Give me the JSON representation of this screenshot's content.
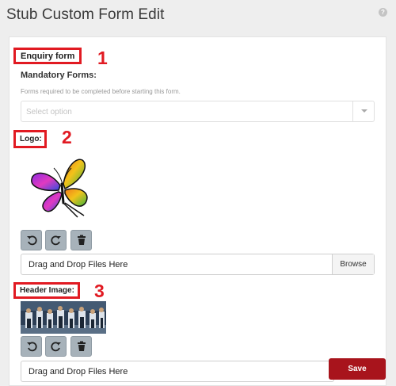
{
  "page": {
    "title": "Stub Custom Form Edit",
    "help_icon_text": "?"
  },
  "form": {
    "title": "Enquiry form",
    "mandatory_label": "Mandatory Forms:",
    "mandatory_help": "Forms required to be completed before starting this form.",
    "select_placeholder": "Select option"
  },
  "logo": {
    "label": "Logo:",
    "image_icon": "butterfly-logo",
    "dropzone_text": "Drag and Drop Files Here",
    "browse_label": "Browse"
  },
  "header_image": {
    "label": "Header Image:",
    "image_icon": "group-photo",
    "dropzone_text": "Drag and Drop Files Here"
  },
  "toolbar_icons": [
    "rotate-left-icon",
    "rotate-right-icon",
    "trash-icon"
  ],
  "annotations": [
    "1",
    "2",
    "3"
  ],
  "actions": {
    "save_label": "Save"
  },
  "colors": {
    "accent": "#e11a22",
    "save": "#a8141c",
    "icon_button": "#a7b2ba"
  }
}
